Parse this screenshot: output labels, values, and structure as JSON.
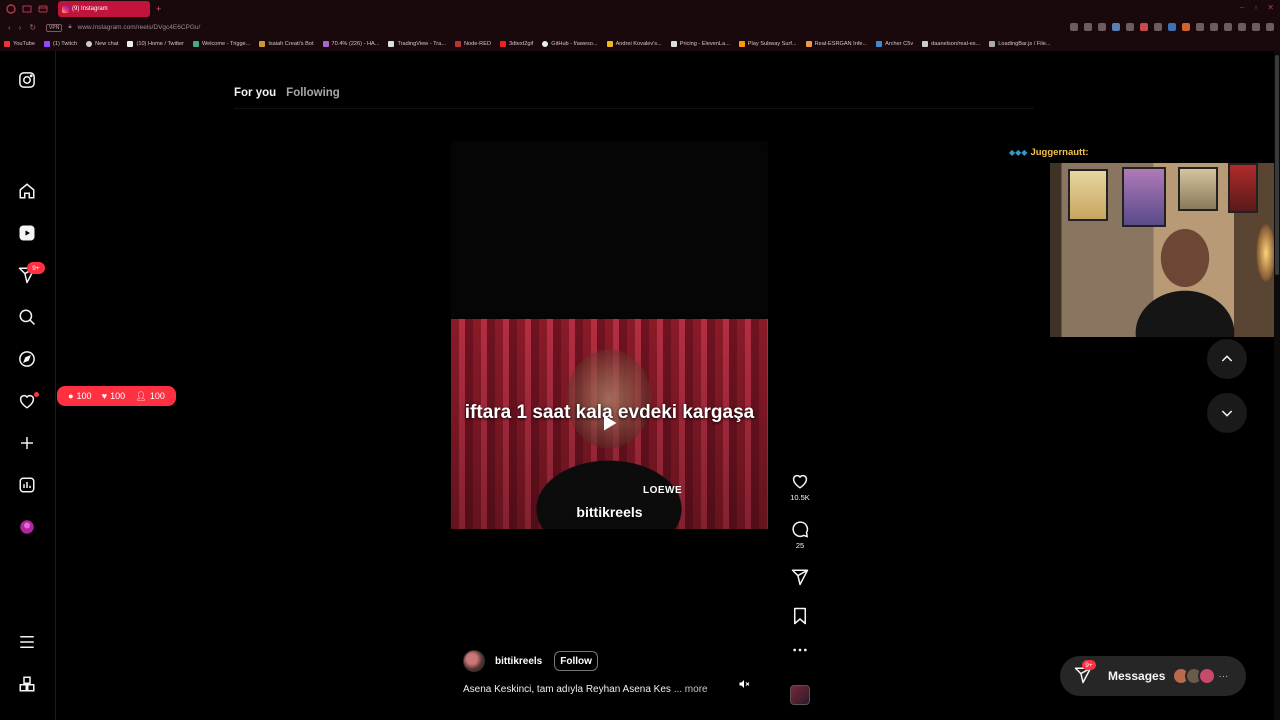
{
  "browser": {
    "tab_title": "(9) Instagram",
    "new_tab_symbol": "+",
    "vpn_label": "VPN",
    "url": "www.instagram.com/reels/DVgc4E6CPGu/",
    "bookmarks": [
      "YouTube",
      "(1) Twitch",
      "New chat",
      "(10) Home / Twitter",
      "Welcome - Trigge...",
      "Isaiah Creati's Bot",
      "70.4% (226) - HA...",
      "TradingView - Tra...",
      "Node-RED",
      "3dtext2gif",
      "GitHub - f/aweso...",
      "Andrei Kovalev's...",
      "Pricing - ElevenLa...",
      "Play Subway Surf...",
      "Real-ESRGAN Infe...",
      "Archer C5v",
      "daanelson/real-es...",
      "LoadingBar.js / File..."
    ]
  },
  "feed_tabs": {
    "for_you": "For you",
    "following": "Following"
  },
  "sidebar": {
    "notification_badge": "9+",
    "activity_pill": {
      "comments": "100",
      "likes": "100",
      "follows": "100"
    }
  },
  "reel": {
    "overlay_caption": "iftara 1 saat kala evdeki kargaşa",
    "overlay_handle": "bittikreels",
    "brand_tag": "LOEWE",
    "author": "bittikreels",
    "follow_label": "Follow",
    "caption": "Asena Keskinci, tam adıyla Reyhan Asena Kes",
    "caption_more": "... more",
    "likes": "10.5K",
    "comments": "25"
  },
  "stream": {
    "viewer_name": "Juggernautt:"
  },
  "messages": {
    "label": "Messages",
    "badge": "9+"
  },
  "colors": {
    "accent": "#ff3040",
    "background": "#000000",
    "text": "#f5f5f5",
    "tab_active": "#c0143c"
  },
  "icons": [
    "instagram-logo-icon",
    "home-icon",
    "reels-icon",
    "send-icon",
    "search-icon",
    "explore-icon",
    "heart-icon",
    "create-icon",
    "dashboard-icon",
    "more-menu-icon",
    "apps-icon",
    "play-icon",
    "mute-icon",
    "comment-icon",
    "bookmark-icon",
    "more-icon",
    "chevron-up-icon",
    "chevron-down-icon"
  ]
}
